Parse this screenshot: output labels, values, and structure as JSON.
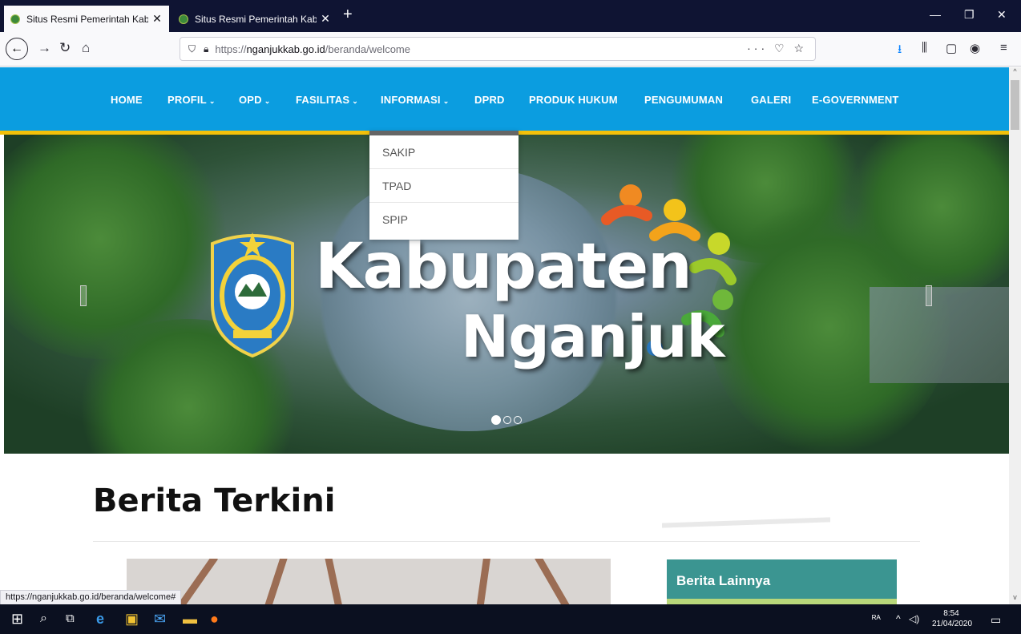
{
  "browser": {
    "tabs": [
      {
        "title": "Situs Resmi Pemerintah Kabupa",
        "active": true
      },
      {
        "title": "Situs Resmi Pemerintah Kabupa",
        "active": false
      }
    ],
    "new_tab": "+",
    "window_controls": {
      "minimize": "—",
      "restore": "❐",
      "close": "✕"
    },
    "url_host_prefix": "https://",
    "url_host": "nganjukkab.go.id",
    "url_path": "/beranda/welcome",
    "url_actions": "··· ♡ ☆",
    "status_url": "https://nganjukkab.go.id/beranda/welcome#"
  },
  "site_nav": {
    "items": [
      {
        "label": "HOME",
        "has_menu": false
      },
      {
        "label": "PROFIL",
        "has_menu": true
      },
      {
        "label": "OPD",
        "has_menu": true
      },
      {
        "label": "FASILITAS",
        "has_menu": true
      },
      {
        "label": "INFORMASI",
        "has_menu": true
      },
      {
        "label": "DPRD",
        "has_menu": false
      },
      {
        "label": "PRODUK HUKUM",
        "has_menu": false
      },
      {
        "label": "PENGUMUMAN",
        "has_menu": false
      },
      {
        "label": "GALERI",
        "has_menu": false
      },
      {
        "label": "E-GOVERNMENT",
        "has_menu": false
      }
    ],
    "chevron": "⌄",
    "dropdown": [
      "SAKIP",
      "TPAD",
      "SPIP"
    ]
  },
  "hero": {
    "line1": "Kabupaten",
    "line2": "Nganjuk",
    "active_slide": 1,
    "slide_count": 3
  },
  "main": {
    "heading": "Berita Terkini",
    "sidebar_title": "Berita Lainnya"
  },
  "taskbar": {
    "time": "8:54",
    "date": "21/04/2020"
  },
  "colors": {
    "nav_blue": "#0b9de0",
    "nav_accent": "#f3c10a",
    "sidebar_teal": "#3b9591"
  }
}
